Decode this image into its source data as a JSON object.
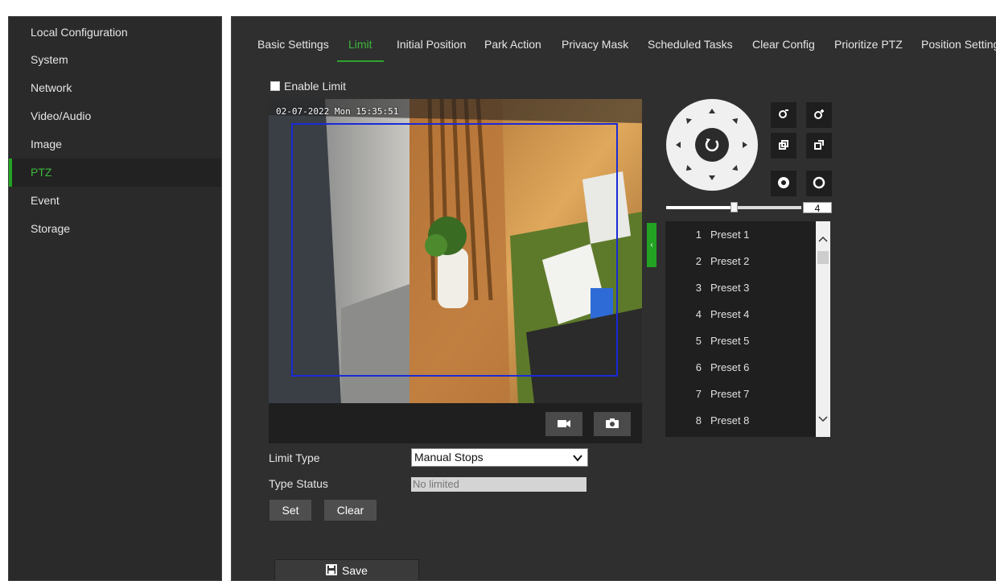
{
  "sidebar": {
    "items": [
      {
        "label": "Local Configuration",
        "active": false
      },
      {
        "label": "System",
        "active": false
      },
      {
        "label": "Network",
        "active": false
      },
      {
        "label": "Video/Audio",
        "active": false
      },
      {
        "label": "Image",
        "active": false
      },
      {
        "label": "PTZ",
        "active": true
      },
      {
        "label": "Event",
        "active": false
      },
      {
        "label": "Storage",
        "active": false
      }
    ]
  },
  "tabs": [
    {
      "label": "Basic Settings",
      "active": false
    },
    {
      "label": "Limit",
      "active": true
    },
    {
      "label": "Initial Position",
      "active": false
    },
    {
      "label": "Park Action",
      "active": false
    },
    {
      "label": "Privacy Mask",
      "active": false
    },
    {
      "label": "Scheduled Tasks",
      "active": false
    },
    {
      "label": "Clear Config",
      "active": false
    },
    {
      "label": "Prioritize PTZ",
      "active": false
    },
    {
      "label": "Position Settings",
      "active": false
    }
  ],
  "enable_limit": {
    "label": "Enable Limit",
    "checked": false
  },
  "video": {
    "osd_timestamp": "02-07-2022 Mon 15:35:51"
  },
  "limit_type": {
    "label": "Limit Type",
    "value": "Manual Stops"
  },
  "type_status": {
    "label": "Type Status",
    "value": "No limited"
  },
  "buttons": {
    "set": "Set",
    "clear": "Clear",
    "save": "Save"
  },
  "ptz": {
    "speed": "4",
    "speed_fraction": 0.5,
    "presets": [
      {
        "num": "1",
        "name": "Preset 1"
      },
      {
        "num": "2",
        "name": "Preset 2"
      },
      {
        "num": "3",
        "name": "Preset 3"
      },
      {
        "num": "4",
        "name": "Preset 4"
      },
      {
        "num": "5",
        "name": "Preset 5"
      },
      {
        "num": "6",
        "name": "Preset 6"
      },
      {
        "num": "7",
        "name": "Preset 7"
      },
      {
        "num": "8",
        "name": "Preset 8"
      }
    ]
  },
  "colors": {
    "accent": "#22a322",
    "limit_box": "#1a2ad8",
    "panel": "#2f2f2f"
  }
}
